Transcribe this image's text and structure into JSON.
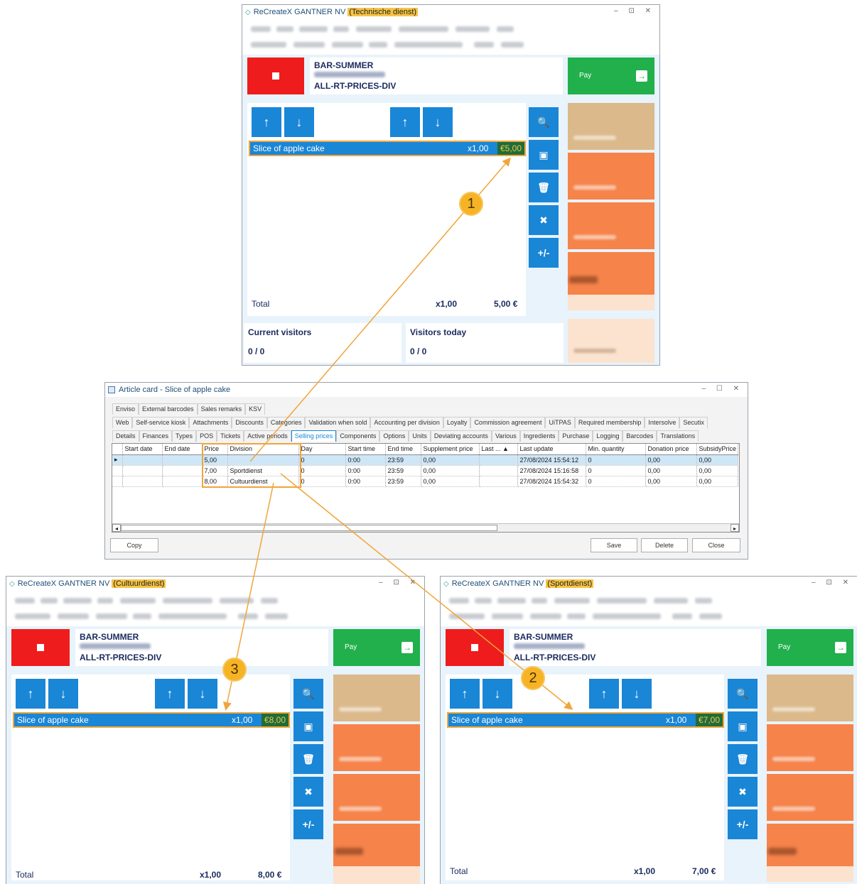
{
  "pos_windows": [
    {
      "app_title": "ReCreateX GANTNER NV",
      "division": "(Technische dienst)",
      "window_controls": "– ⊡ ✕",
      "pos_name": "BAR-SUMMER",
      "price_list": "ALL-RT-PRICES-DIV",
      "pay_label": "Pay",
      "line": {
        "name": "Slice of apple cake",
        "qty": "x1,00",
        "price": "€5,00"
      },
      "total_label": "Total",
      "total_qty": "x1,00",
      "total_amount": "5,00 €",
      "current_visitors_label": "Current visitors",
      "current_visitors_value": "0 / 0",
      "visitors_today_label": "Visitors today",
      "visitors_today_value": "0 / 0"
    },
    {
      "app_title": "ReCreateX GANTNER NV",
      "division": "(Cultuurdienst)",
      "window_controls": "– ⊡ ✕",
      "pos_name": "BAR-SUMMER",
      "price_list": "ALL-RT-PRICES-DIV",
      "pay_label": "Pay",
      "line": {
        "name": "Slice of apple cake",
        "qty": "x1,00",
        "price": "€8,00"
      },
      "total_label": "Total",
      "total_qty": "x1,00",
      "total_amount": "8,00 €"
    },
    {
      "app_title": "ReCreateX GANTNER NV",
      "division": "(Sportdienst)",
      "window_controls": "– ⊡ ✕",
      "pos_name": "BAR-SUMMER",
      "price_list": "ALL-RT-PRICES-DIV",
      "pay_label": "Pay",
      "line": {
        "name": "Slice of apple cake",
        "qty": "x1,00",
        "price": "€7,00"
      },
      "total_label": "Total",
      "total_qty": "x1,00",
      "total_amount": "7,00 €"
    }
  ],
  "icons": {
    "up": "↑",
    "down": "↓",
    "search": "🔍",
    "card": "▣",
    "delete": "🗑",
    "delete_all": "✖",
    "plusminus": "+/-",
    "pay_arrow": "→"
  },
  "article_card": {
    "title": "Article card - Slice of apple cake",
    "window_controls": "– ☐ ✕",
    "tab_rows": [
      [
        "Enviso",
        "External barcodes",
        "Sales remarks",
        "KSV"
      ],
      [
        "Web",
        "Self-service kiosk",
        "Attachments",
        "Discounts",
        "Categories",
        "Validation when sold",
        "Accounting per division",
        "Loyalty",
        "Commission agreement",
        "UiTPAS",
        "Required membership",
        "Intersolve",
        "Secutix"
      ],
      [
        "Details",
        "Finances",
        "Types",
        "POS",
        "Tickets",
        "Active periods",
        "Selling prices",
        "Components",
        "Options",
        "Units",
        "Deviating accounts",
        "Various",
        "Ingredients",
        "Purchase",
        "Logging",
        "Barcodes",
        "Translations"
      ]
    ],
    "active_tab": "Selling prices",
    "columns": [
      "",
      "Start date",
      "End date",
      "Price",
      "Division",
      "Day",
      "Start time",
      "End time",
      "Supplement price",
      "Last ... ▲",
      "Last update",
      "Min. quantity",
      "Donation price",
      "SubsidyPrice"
    ],
    "rows": [
      [
        "▸",
        "",
        "",
        "5,00",
        "",
        "0",
        "0:00",
        "23:59",
        "0,00",
        "",
        "27/08/2024 15:54:12",
        "0",
        "0,00",
        "0,00"
      ],
      [
        "",
        "",
        "",
        "7,00",
        "Sportdienst",
        "0",
        "0:00",
        "23:59",
        "0,00",
        "",
        "27/08/2024 15:16:58",
        "0",
        "0,00",
        "0,00"
      ],
      [
        "",
        "",
        "",
        "8,00",
        "Cultuurdienst",
        "0",
        "0:00",
        "23:59",
        "0,00",
        "",
        "27/08/2024 15:54:32",
        "0",
        "0,00",
        "0,00"
      ]
    ],
    "buttons": {
      "copy": "Copy",
      "save": "Save",
      "delete": "Delete",
      "close": "Close"
    },
    "scroll_left": "◂",
    "scroll_right": "▸"
  },
  "callouts": [
    "1",
    "2",
    "3"
  ],
  "colors": {
    "stop_red": "#ee1c1c",
    "pay_green": "#21b04b",
    "blue_button": "#1a86d6",
    "highlight_orange": "#f0a53a",
    "price_bg": "#1e6d3a",
    "division_yellow": "#f6c445"
  }
}
